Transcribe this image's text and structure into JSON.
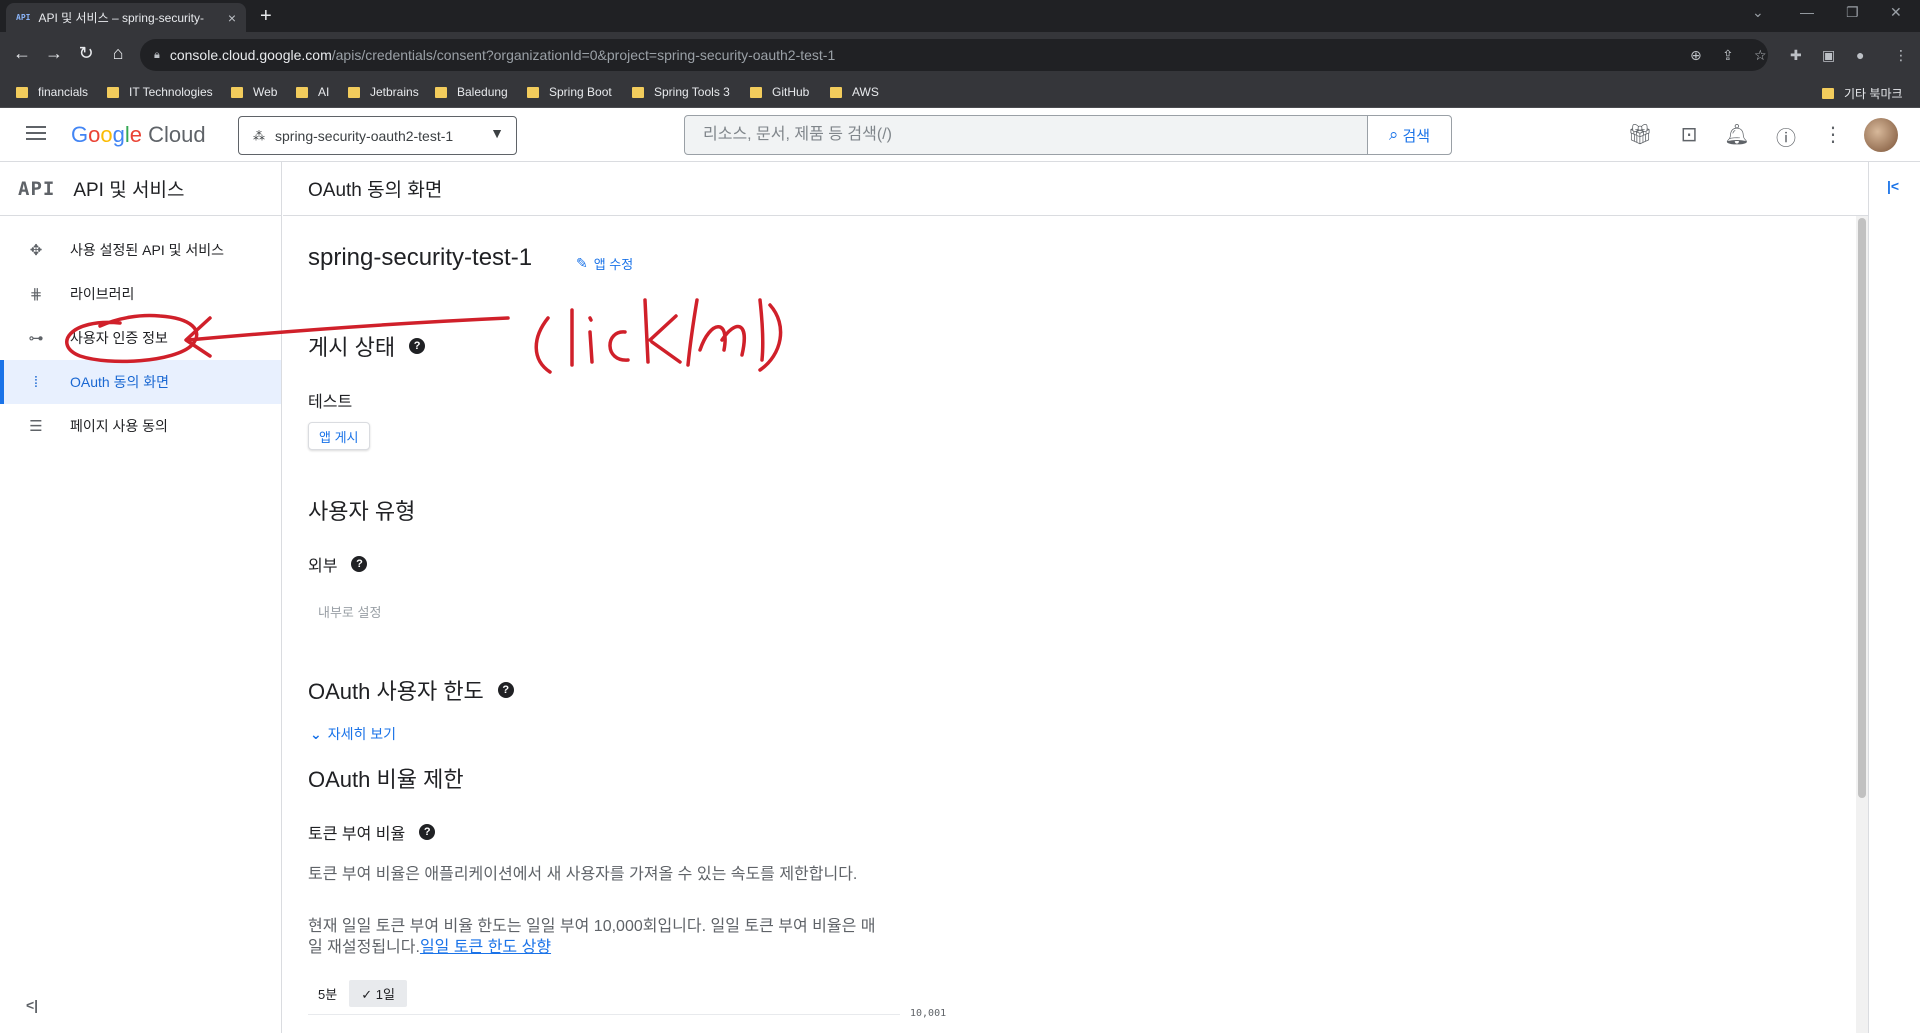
{
  "browser": {
    "tab_favicon": "API",
    "tab_title": "API 및 서비스 – spring-security-",
    "tab_close": "×",
    "new_tab": "+",
    "url_host": "console.cloud.google.com",
    "url_path": "/apis/credentials/consent?organizationId=0&project=spring-security-oauth2-test-1",
    "bookmarks": [
      "financials",
      "IT Technologies",
      "Web",
      "AI",
      "Jetbrains",
      "Baledung",
      "Spring Boot",
      "Spring Tools 3",
      "GitHub",
      "AWS"
    ],
    "other_bookmarks": "기타 북마크"
  },
  "header": {
    "logo_google": "Google",
    "logo_cloud": "Cloud",
    "project_name": "spring-security-oauth2-test-1",
    "search_placeholder": "리소스, 문서, 제품 등 검색(/)",
    "search_button": "검색"
  },
  "sidebar": {
    "badge": "API",
    "title": "API 및 서비스",
    "items": [
      {
        "label": "사용 설정된 API 및 서비스",
        "icon": "diamond-dots-icon"
      },
      {
        "label": "라이브러리",
        "icon": "library-icon"
      },
      {
        "label": "사용자 인증 정보",
        "icon": "key-icon"
      },
      {
        "label": "OAuth 동의 화면",
        "icon": "consent-grid-icon"
      },
      {
        "label": "페이지 사용 동의",
        "icon": "settings-list-icon"
      }
    ],
    "active_index": 3
  },
  "main": {
    "page_title": "OAuth 동의 화면",
    "app_name": "spring-security-test-1",
    "edit_app": "앱 수정",
    "publish_status_heading": "게시 상태",
    "publish_status_value": "테스트",
    "publish_button": "앱 게시",
    "user_type_heading": "사용자 유형",
    "user_type_value": "외부",
    "make_internal_button": "내부로 설정",
    "user_cap_heading": "OAuth 사용자 한도",
    "see_more": "자세히 보기",
    "rate_limit_heading": "OAuth 비율 제한",
    "token_rate_label": "토큰 부여 비율",
    "token_rate_desc": "토큰 부여 비율은 애플리케이션에서 새 사용자를 가져올 수 있는 속도를 제한합니다.",
    "token_rate_current": "현재 일일 토큰 부여 비율 한도는 일일 부여 10,000회입니다. 일일 토큰 부여 비율은 매일 재설정됩니다.",
    "token_rate_link": "일일 토큰 한도 상향",
    "range_5min": "5분",
    "range_1day": "1일",
    "chart_tick": "10,001"
  },
  "annotation": {
    "handwriting": "(click!!)",
    "color": "#d0202a"
  },
  "colors": {
    "accent": "#1a73e8",
    "active_bg": "#e8f0fe",
    "chrome_dark": "#35363a"
  }
}
